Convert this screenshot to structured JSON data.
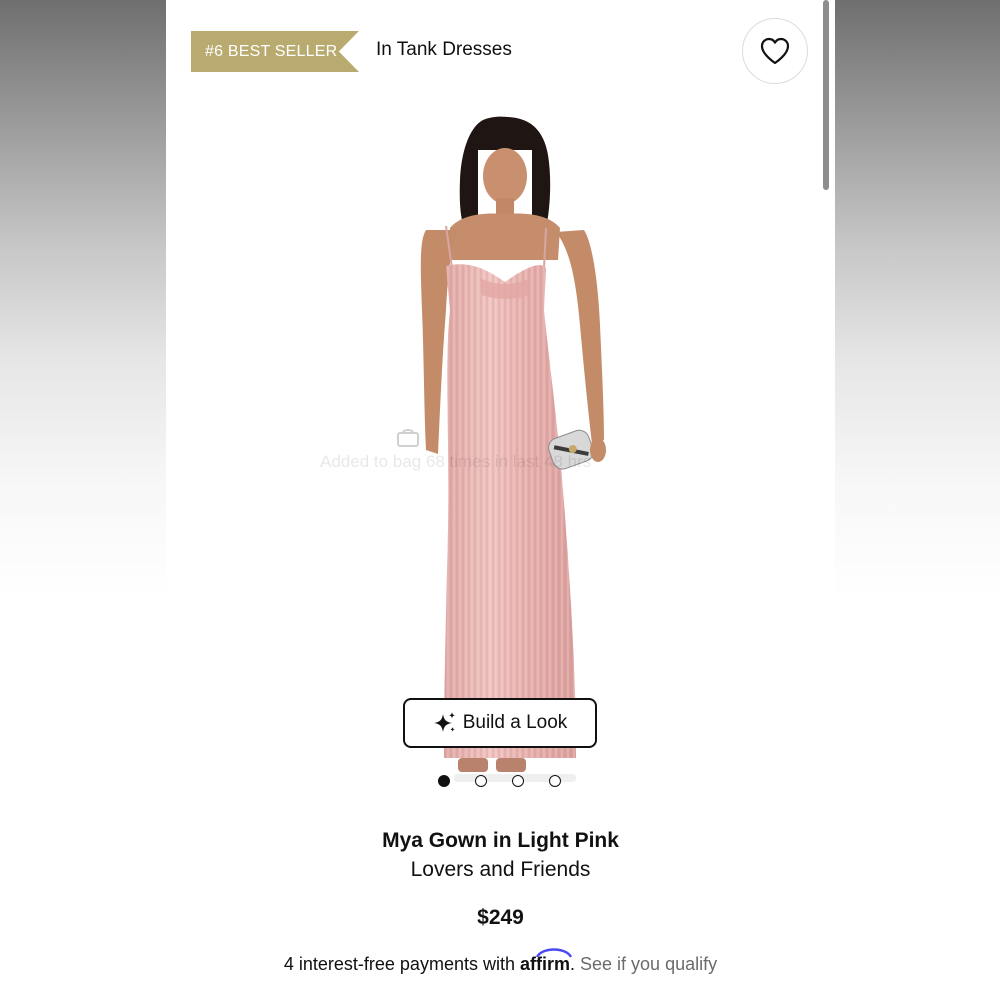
{
  "header": {
    "badge": "#6 BEST SELLER",
    "category": "In Tank Dresses",
    "favorite_icon": "heart-icon"
  },
  "overlay": {
    "added_text": "Added to bag 68 times in last 48 hrs",
    "icon": "bag-icon"
  },
  "build_look": {
    "label": "Build a Look",
    "icon": "sparkle-icon"
  },
  "carousel": {
    "count": 4,
    "active": 1
  },
  "product": {
    "title": "Mya Gown in Light Pink",
    "brand": "Lovers and Friends",
    "price": "$249"
  },
  "payment": {
    "prefix": "4 interest-free payments with ",
    "provider": "affirm",
    "suffix": ". ",
    "link": "See if you qualify"
  },
  "colors": {
    "badge": "#b9ab6f",
    "text": "#111111",
    "muted": "#6b6b6b",
    "gown": "#e9b4b2",
    "affirm_arc": "#4a4af4"
  }
}
